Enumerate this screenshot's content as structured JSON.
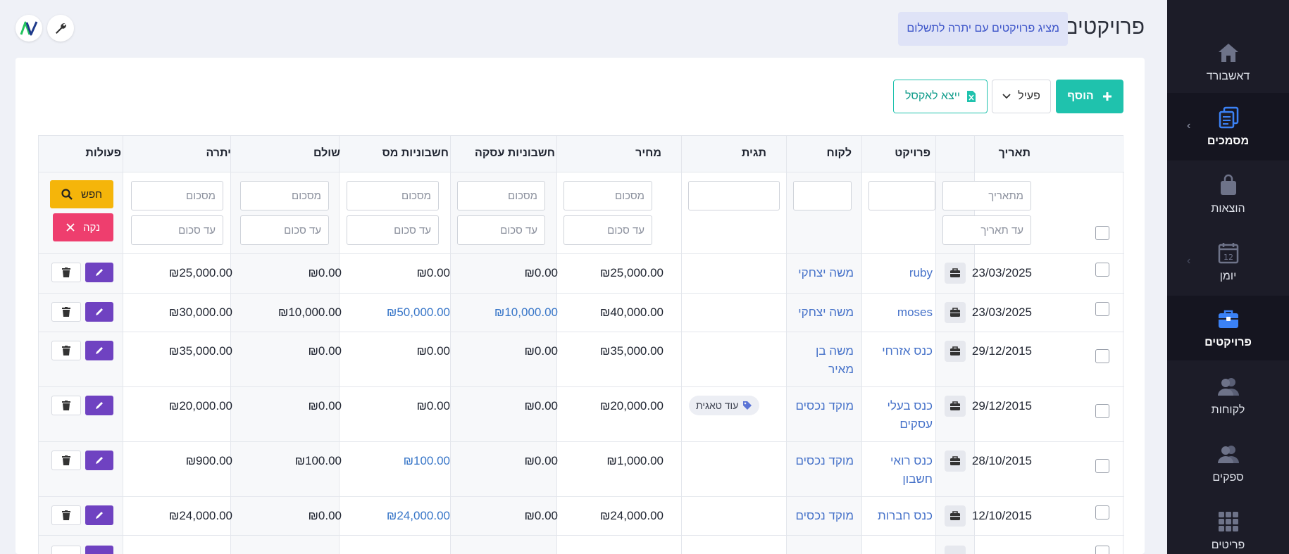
{
  "sidebar": {
    "items": [
      {
        "label": "דאשבורד",
        "icon": "home-icon"
      },
      {
        "label": "מסמכים",
        "icon": "documents-icon"
      },
      {
        "label": "הוצאות",
        "icon": "shopping-bag-icon"
      },
      {
        "label": "יומן",
        "icon": "calendar-icon",
        "day": "12"
      },
      {
        "label": "פרויקטים",
        "icon": "briefcase-icon"
      },
      {
        "label": "לקוחות",
        "icon": "users-icon"
      },
      {
        "label": "ספקים",
        "icon": "suppliers-icon"
      },
      {
        "label": "פריטים",
        "icon": "grid-icon"
      }
    ]
  },
  "header": {
    "title": "פרויקטים",
    "info": "מציג פרויקטים עם יתרה לתשלום"
  },
  "toolbar": {
    "add": "הוסף",
    "status": "פעיל",
    "excel": "ייצא לאקסל"
  },
  "table": {
    "columns": {
      "date": "תאריך",
      "project": "פרויקט",
      "client": "לקוח",
      "tag": "תגית",
      "price": "מחיר",
      "invoices": "חשבוניות עסקה",
      "tax_invoices": "חשבוניות מס",
      "paid": "שולם",
      "balance": "יתרה",
      "actions": "פעולות"
    },
    "filters": {
      "from_date": "מתאריך",
      "to_date": "עד תאריך",
      "from_amount": "מסכום",
      "to_amount": "עד סכום",
      "search": "חפש",
      "clear": "נקה"
    },
    "rows": [
      {
        "date": "23/03/2025",
        "project": "ruby",
        "client": "משה יצחקי",
        "tag": "",
        "price": "₪25,000.00",
        "invoices": "₪0.00",
        "tax_invoices": "₪0.00",
        "paid": "₪0.00",
        "balance": "₪25,000.00"
      },
      {
        "date": "23/03/2025",
        "project": "moses",
        "client": "משה יצחקי",
        "tag": "",
        "price": "₪40,000.00",
        "invoices": "₪10,000.00",
        "tax_invoices": "₪50,000.00",
        "paid": "₪10,000.00",
        "balance": "₪30,000.00"
      },
      {
        "date": "29/12/2015",
        "project": "כנס אזרחי",
        "client": "משה בן מאיר",
        "tag": "",
        "price": "₪35,000.00",
        "invoices": "₪0.00",
        "tax_invoices": "₪0.00",
        "paid": "₪0.00",
        "balance": "₪35,000.00"
      },
      {
        "date": "29/12/2015",
        "project": "כנס בעלי עסקים",
        "client": "מוקד נכסים",
        "tag": "עוד טאגית",
        "price": "₪20,000.00",
        "invoices": "₪0.00",
        "tax_invoices": "₪0.00",
        "paid": "₪0.00",
        "balance": "₪20,000.00"
      },
      {
        "date": "28/10/2015",
        "project": "כנס רואי חשבון",
        "client": "מוקד נכסים",
        "tag": "",
        "price": "₪1,000.00",
        "invoices": "₪0.00",
        "tax_invoices": "₪100.00",
        "paid": "₪100.00",
        "balance": "₪900.00"
      },
      {
        "date": "12/10/2015",
        "project": "כנס חברות",
        "client": "מוקד נכסים",
        "tag": "",
        "price": "₪24,000.00",
        "invoices": "₪0.00",
        "tax_invoices": "₪24,000.00",
        "paid": "₪0.00",
        "balance": "₪24,000.00"
      }
    ]
  },
  "colors": {
    "accent": "#1fc2ad",
    "sidebar_bg": "#1c1c28",
    "edit": "#6f42c1",
    "search": "#f5b50a",
    "clear": "#ee3e6e",
    "link": "#4672c9"
  }
}
